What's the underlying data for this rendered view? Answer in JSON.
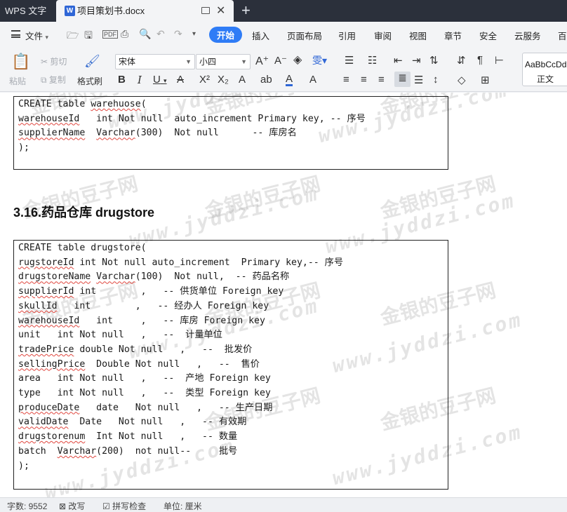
{
  "titlebar": {
    "app_name": "WPS 文字",
    "doc_icon": "W",
    "doc_name": "项目策划书.docx",
    "close_glyph": "✕",
    "new_tab_glyph": "+"
  },
  "menubar": {
    "file_label": "文件",
    "tabs": [
      "开始",
      "插入",
      "页面布局",
      "引用",
      "审阅",
      "视图",
      "章节",
      "安全",
      "云服务",
      "百"
    ]
  },
  "toolbar": {
    "paste_label": "粘贴",
    "cut_label": "剪切",
    "copy_label": "复制",
    "format_painter_label": "格式刷",
    "font_name": "宋体",
    "font_size": "小四",
    "bold": "B",
    "italic": "I",
    "underline": "U",
    "style_sample": "AaBbCcDd",
    "style_name": "正文"
  },
  "document": {
    "box1_lines": [
      [
        {
          "t": "CREATE table "
        },
        {
          "t": "warehuose",
          "w": true
        },
        {
          "t": "("
        }
      ],
      [
        {
          "t": "warehouseId",
          "w": true
        },
        {
          "t": "   int Not null  auto_increment Primary key, -- 序号"
        }
      ],
      [
        {
          "t": "supplierName",
          "w": true
        },
        {
          "t": "  "
        },
        {
          "t": "Varchar",
          "w": true
        },
        {
          "t": "(300)  Not null      -- 库房名"
        }
      ],
      [
        {
          "t": ");"
        }
      ]
    ],
    "heading": "3.16.药品仓库 drugstore",
    "box2_lines": [
      [
        {
          "t": "CREATE table drugstore("
        }
      ],
      [
        {
          "t": "rugstoreId",
          "w": true
        },
        {
          "t": " int Not null auto_increment  Primary key,-- 序号"
        }
      ],
      [
        {
          "t": "drugstoreName",
          "w": true
        },
        {
          "t": " "
        },
        {
          "t": "Varchar",
          "w": true
        },
        {
          "t": "(100)  Not null,  -- 药品名称"
        }
      ],
      [
        {
          "t": "supplierId",
          "w": true
        },
        {
          "t": " int        ,   -- 供货单位 Foreign key"
        }
      ],
      [
        {
          "t": "skullId",
          "w": true
        },
        {
          "t": "   int        ,   -- 经办人 Foreign key"
        }
      ],
      [
        {
          "t": "warehouseId",
          "w": true
        },
        {
          "t": "   int     ,   -- 库房 Foreign key"
        }
      ],
      [
        {
          "t": "unit   int Not null   ,   --  计量单位"
        }
      ],
      [
        {
          "t": "tradePrice",
          "w": true
        },
        {
          "t": " double Not null   ,   --  批发价"
        }
      ],
      [
        {
          "t": "sellingPrice",
          "w": true
        },
        {
          "t": "  Double Not null   ,   --  售价"
        }
      ],
      [
        {
          "t": "area   int Not null   ,   --  产地 Foreign key"
        }
      ],
      [
        {
          "t": "type   int Not null   ,   --  类型 Foreign key"
        }
      ],
      [
        {
          "t": "produceDate",
          "w": true
        },
        {
          "t": "   date   Not null   ,   -- 生产日期"
        }
      ],
      [
        {
          "t": "validDate",
          "w": true
        },
        {
          "t": "  Date   Not null   ,   -- 有效期"
        }
      ],
      [
        {
          "t": "drugstorenum",
          "w": true
        },
        {
          "t": "  Int Not null   ,   -- 数量"
        }
      ],
      [
        {
          "t": "batch  "
        },
        {
          "t": "Varchar",
          "w": true
        },
        {
          "t": "(200)  not null--     批号"
        }
      ],
      [
        {
          "t": ");"
        }
      ]
    ]
  },
  "watermark": {
    "cn": "金银的豆子网",
    "url": "www.jyddzi.com"
  },
  "statusbar": {
    "word_count": "字数: 9552",
    "revise": "改写",
    "spellcheck": "拼写检查",
    "unit": "单位: 厘米"
  }
}
